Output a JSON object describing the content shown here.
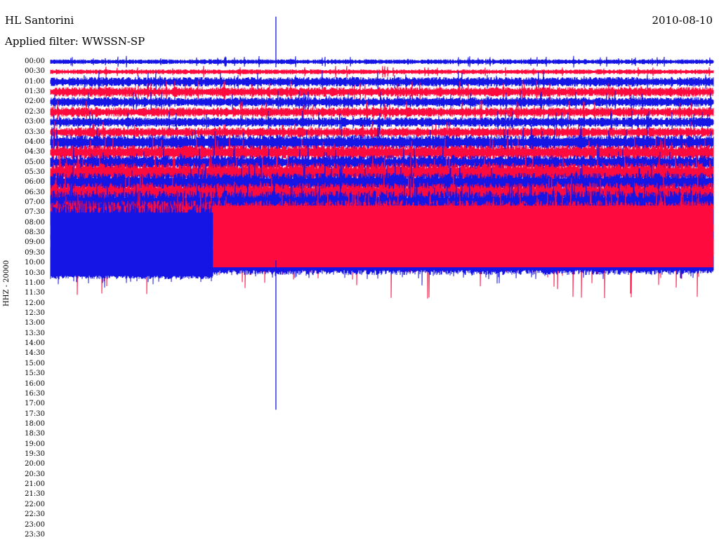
{
  "header": {
    "station": "HL Santorini",
    "date": "2010-08-10",
    "filter": "Applied filter: WWSSN-SP",
    "channel": "HHZ - 20000"
  },
  "colors": {
    "trace_a": "#1515e6",
    "trace_b": "#ff0a3e",
    "background": "#ffffff",
    "text": "#000000"
  },
  "chart_data": {
    "type": "line",
    "title": "HL Santorini",
    "subtitle": "Applied filter: WWSSN-SP",
    "date": "2010-08-10",
    "ylabel": "HHZ - 20000",
    "y_tick_labels": [
      "00:00",
      "00:30",
      "01:00",
      "01:30",
      "02:00",
      "02:30",
      "03:00",
      "03:30",
      "04:00",
      "04:30",
      "05:00",
      "05:30",
      "06:00",
      "06:30",
      "07:00",
      "07:30",
      "08:00",
      "08:30",
      "09:00",
      "09:30",
      "10:00",
      "10:30",
      "11:00",
      "11:30",
      "12:00",
      "12:30",
      "13:00",
      "13:30",
      "14:00",
      "14:30",
      "15:00",
      "15:30",
      "16:00",
      "16:30",
      "17:00",
      "17:30",
      "18:00",
      "18:30",
      "19:00",
      "19:30",
      "20:00",
      "20:30",
      "21:00",
      "21:30",
      "22:00",
      "22:30",
      "23:00",
      "23:30"
    ],
    "x_range_minutes": [
      0,
      30
    ],
    "rows_with_data": 21,
    "row_colors_alternate": [
      "trace_a",
      "trace_b"
    ],
    "row_activity_level": [
      1,
      1,
      2,
      2,
      2,
      2,
      2,
      2,
      3,
      3,
      3,
      4,
      4,
      4,
      5,
      5,
      8,
      8,
      8,
      8,
      8
    ],
    "row_10_00_saturated_until_fraction": 0.245,
    "events": [
      {
        "row": "00:00",
        "at_fraction": 0.34,
        "spike_up_rows": 2,
        "spike_down_rows": 0
      },
      {
        "row": "10:00",
        "at_fraction": 0.34,
        "spike_up_rows": 0,
        "spike_down_rows": 14
      }
    ],
    "grid": false
  }
}
